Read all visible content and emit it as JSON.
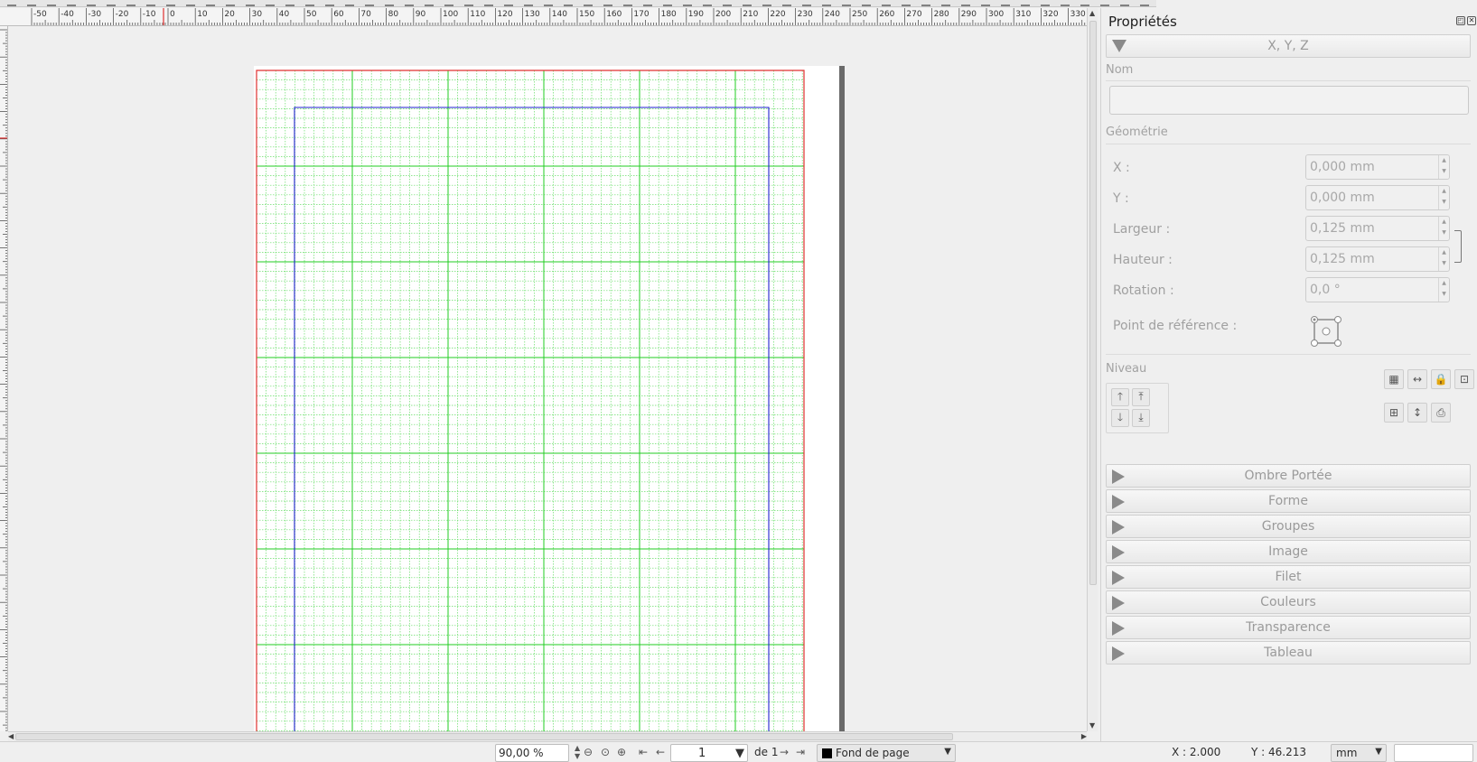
{
  "window": {
    "panel_title": "Propriétés"
  },
  "ruler": {
    "top_labels": [
      "-50",
      "-40",
      "-30",
      "-20",
      "-10",
      "0",
      "10",
      "20",
      "30",
      "40",
      "50",
      "60",
      "70",
      "80",
      "90",
      "100",
      "110",
      "120",
      "130",
      "140",
      "150",
      "160",
      "170",
      "180",
      "190",
      "200",
      "210",
      "220",
      "230",
      "240",
      "250",
      "260",
      "270",
      "280",
      "290",
      "300",
      "310",
      "320",
      "330"
    ]
  },
  "properties": {
    "xyz_header": "X, Y, Z",
    "nom_label": "Nom",
    "nom_value": "",
    "geometry_label": "Géométrie",
    "fields": [
      {
        "label": "X :",
        "value": "0,000 mm"
      },
      {
        "label": "Y :",
        "value": "0,000 mm"
      },
      {
        "label": "Largeur :",
        "value": "0,125 mm"
      },
      {
        "label": "Hauteur :",
        "value": "0,125 mm"
      },
      {
        "label": "Rotation :",
        "value": "0,0 °"
      }
    ],
    "refpoint_label": "Point de référence :",
    "niveau_label": "Niveau",
    "sections": [
      "Ombre Portée",
      "Forme",
      "Groupes",
      "Image",
      "Filet",
      "Couleurs",
      "Transparence",
      "Tableau"
    ]
  },
  "statusbar": {
    "zoom": "90,00 %",
    "page_number": "1",
    "page_of": "de 1",
    "layer": "Fond de page",
    "x_coord": "X : 2.000",
    "y_coord": "Y : 46.213",
    "unit": "mm"
  },
  "colors": {
    "margin_red": "#e03030",
    "guide_blue": "#2020d0",
    "grid_major": "#22cc22",
    "grid_minor": "#66dd66"
  }
}
